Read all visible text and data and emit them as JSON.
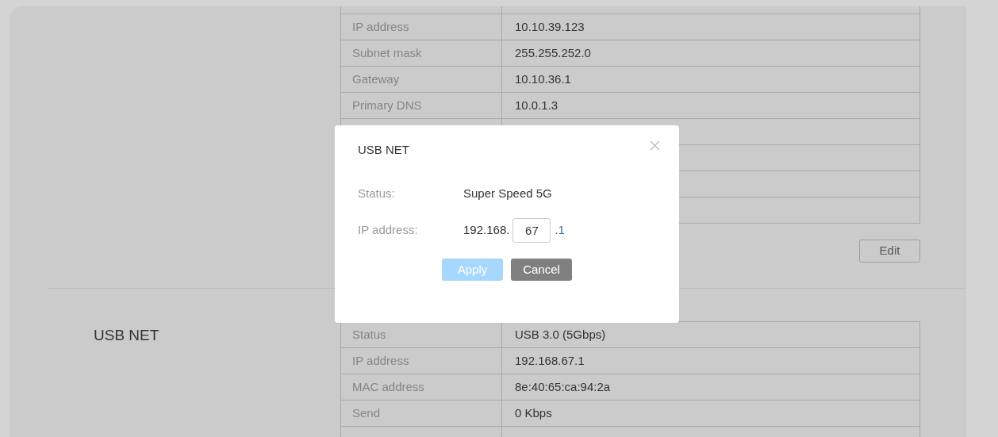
{
  "sections": [
    {
      "rows": [
        {
          "kind": "pair",
          "label": "IP address",
          "value": "10.10.39.123"
        },
        {
          "kind": "pair",
          "label": "Subnet mask",
          "value": "255.255.252.0"
        },
        {
          "kind": "pair",
          "label": "Gateway",
          "value": "10.10.36.1"
        },
        {
          "kind": "pair",
          "label": "Primary DNS",
          "value": "10.0.1.3"
        },
        {
          "kind": "blank"
        },
        {
          "kind": "blank"
        },
        {
          "kind": "blank"
        },
        {
          "kind": "blank"
        }
      ],
      "button": "Edit"
    },
    {
      "title": "USB NET",
      "rows": [
        {
          "kind": "pair",
          "label": "Status",
          "value": "USB 3.0 (5Gbps)"
        },
        {
          "kind": "pair",
          "label": "IP address",
          "value": "192.168.67.1"
        },
        {
          "kind": "pair",
          "label": "MAC address",
          "value": "8e:40:65:ca:94:2a"
        },
        {
          "kind": "pair",
          "label": "Send",
          "value": "0 Kbps"
        }
      ]
    }
  ],
  "dialog": {
    "title": "USB NET",
    "status_label": "Status:",
    "status_value": "Super Speed 5G",
    "ip_label": "IP address:",
    "ip_prefix": "192.168.",
    "ip_octet": "67",
    "ip_suffix": ".1",
    "buttons": [
      {
        "label": "Apply",
        "kind": "primary",
        "disabled": true
      },
      {
        "label": "Cancel",
        "kind": "secondary",
        "disabled": false
      }
    ]
  }
}
